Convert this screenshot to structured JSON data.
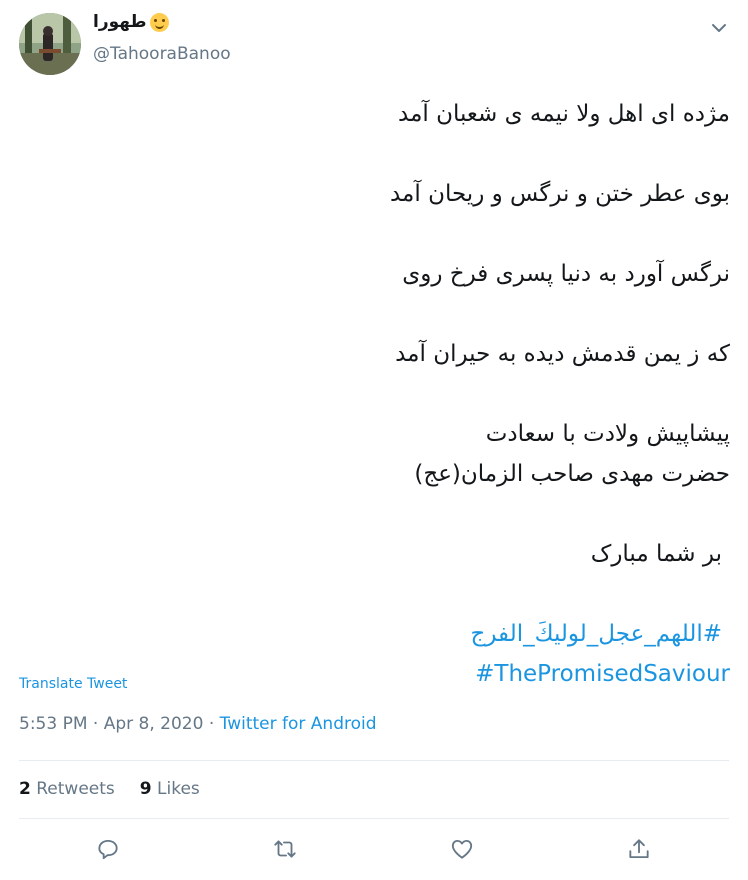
{
  "author": {
    "display_name": "طهورا",
    "emoji": "smiling-face-emoji",
    "handle": "@TahooraBanoo"
  },
  "tweet": {
    "lines": [
      "مژده ای اهل ولا نیمه ی شعبان آمد",
      "بوی عطر ختن و نرگس و ریحان آمد",
      "نرگس آورد به دنیا پسری فرخ روی",
      "که ز یمن قدمش دیده به حیران آمد",
      "پیشاپیش ولادت با سعادت",
      "حضرت مهدی صاحب الزمان(عج)",
      "بر شما مبارک"
    ],
    "hashtags": [
      "#اللهم_عجل_لوليكَ_الفرج",
      "#ThePromisedSaviour"
    ]
  },
  "translate_label": "Translate Tweet",
  "meta": {
    "time": "5:53 PM",
    "separator": "·",
    "date": "Apr 8, 2020",
    "source": "Twitter for Android"
  },
  "stats": {
    "retweets_count": "2",
    "retweets_label": "Retweets",
    "likes_count": "9",
    "likes_label": "Likes"
  },
  "actions": [
    "reply-icon",
    "retweet-icon",
    "like-icon",
    "share-icon"
  ],
  "colors": {
    "link": "#1b95e0",
    "secondary": "#657786",
    "text": "#14171a",
    "divider": "#e6ecf0"
  }
}
